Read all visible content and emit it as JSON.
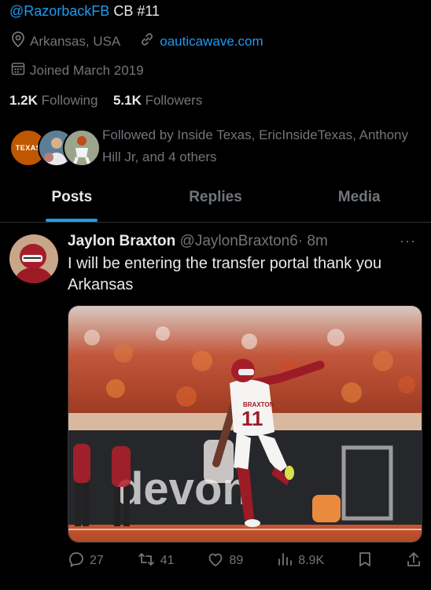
{
  "profile": {
    "handle_link": "@RazorbackFB",
    "bio_suffix": " CB #11",
    "location": "Arkansas, USA",
    "website": "oauticawave.com",
    "joined": "Joined March 2019",
    "following_count": "1.2K",
    "following_label": "Following",
    "followers_count": "5.1K",
    "followers_label": "Followers",
    "followed_by": "Followed by Inside Texas, EricInsideTexas, Anthony Hill Jr, and 4 others",
    "texas_logo_text": "TEXAS"
  },
  "tabs": [
    {
      "label": "Posts"
    },
    {
      "label": "Replies"
    },
    {
      "label": "Media"
    }
  ],
  "post": {
    "author_name": "Jaylon Braxton",
    "author_handle": "@JaylonBraxton6",
    "time": "· 8m",
    "more": "···",
    "text": "I will be entering the transfer portal thank you Arkansas",
    "jersey_name": "BRAXTON",
    "jersey_number": "11",
    "banner_text": "devon",
    "stats": {
      "replies": "27",
      "reposts": "41",
      "likes": "89",
      "views": "8.9K"
    }
  },
  "colors": {
    "background": "#000000",
    "accent": "#1d9bf0",
    "secondary_text": "#71767b",
    "texas_orange": "#bf5700",
    "arkansas_red": "#9d2235"
  }
}
